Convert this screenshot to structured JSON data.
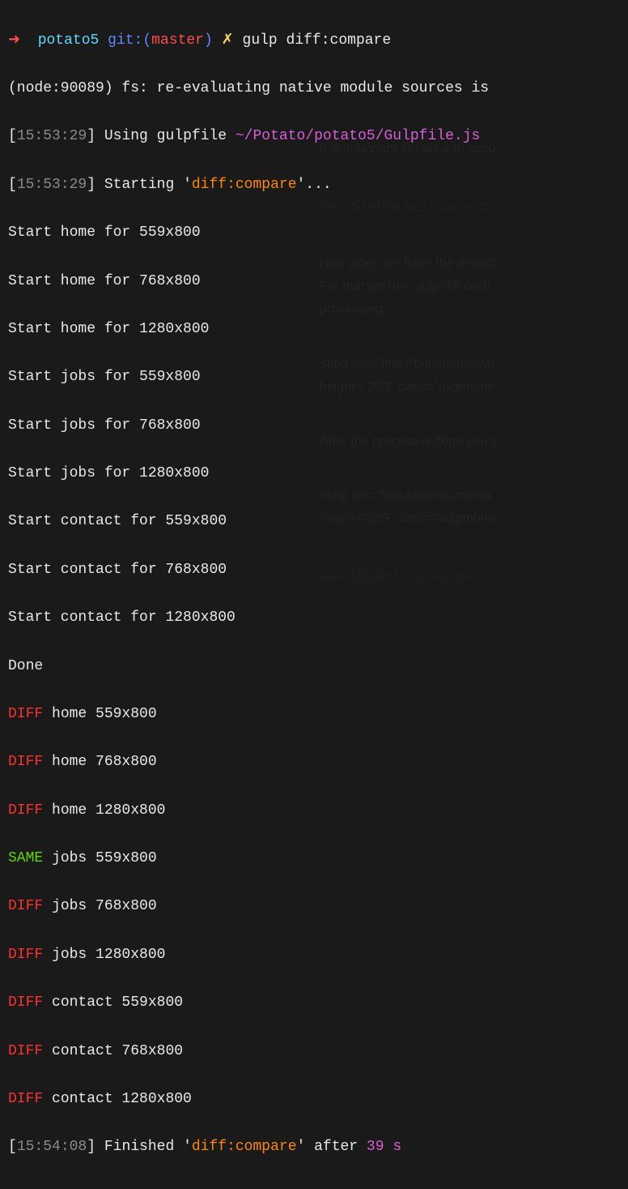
{
  "prompt": {
    "arrow": "➜",
    "dir": "potato5",
    "git_label": "git:",
    "branch": "master",
    "lightning": "✗",
    "command": "gulp diff:compare"
  },
  "node_warning": "(node:90089) fs: re-evaluating native module sources is",
  "lines": {
    "using": {
      "ts_open": "[",
      "ts": "15:53:29",
      "ts_close": "]",
      "text": " Using gulpfile ",
      "path": "~/Potato/potato5/Gulpfile.js"
    },
    "starting": {
      "ts_open": "[",
      "ts": "15:53:29",
      "ts_close": "]",
      "text": " Starting '",
      "task": "diff:compare",
      "after": "'..."
    },
    "starts": [
      "Start home for 559x800",
      "Start home for 768x800",
      "Start home for 1280x800",
      "Start jobs for 559x800",
      "Start jobs for 768x800",
      "Start jobs for 1280x800",
      "Start contact for 559x800",
      "Start contact for 768x800",
      "Start contact for 1280x800"
    ],
    "done": "Done",
    "results": [
      {
        "status": "DIFF",
        "rest": " home 559x800"
      },
      {
        "status": "DIFF",
        "rest": " home 768x800"
      },
      {
        "status": "DIFF",
        "rest": " home 1280x800"
      },
      {
        "status": "SAME",
        "rest": " jobs 559x800"
      },
      {
        "status": "DIFF",
        "rest": " jobs 768x800"
      },
      {
        "status": "DIFF",
        "rest": " jobs 1280x800"
      },
      {
        "status": "DIFF",
        "rest": " contact 559x800"
      },
      {
        "status": "DIFF",
        "rest": " contact 768x800"
      },
      {
        "status": "DIFF",
        "rest": " contact 1280x800"
      }
    ],
    "finished": {
      "ts_open": "[",
      "ts": "15:54:08",
      "ts_close": "]",
      "text1": " Finished '",
      "task": "diff:compare",
      "text2": "' after ",
      "duration": "39 s"
    }
  },
  "bg": {
    "line1": "It is important to take into acco",
    "heading1": "### Stable version scre",
    "line2": "Now when we have the project ",
    "line3": "For that we run `gulp diff:cach",
    "line4": "processing.",
    "img1a": "<img src=\"http://bumbu.me/wp",
    "img1b": "height=\"260\" class=\"alignnone",
    "line5": "After the process is done you s",
    "img2a": "<img src=\"http://bumbu.me/wr",
    "img2b": "height=\"309\" class=\"alignnone",
    "heading2": "### Website changes"
  }
}
